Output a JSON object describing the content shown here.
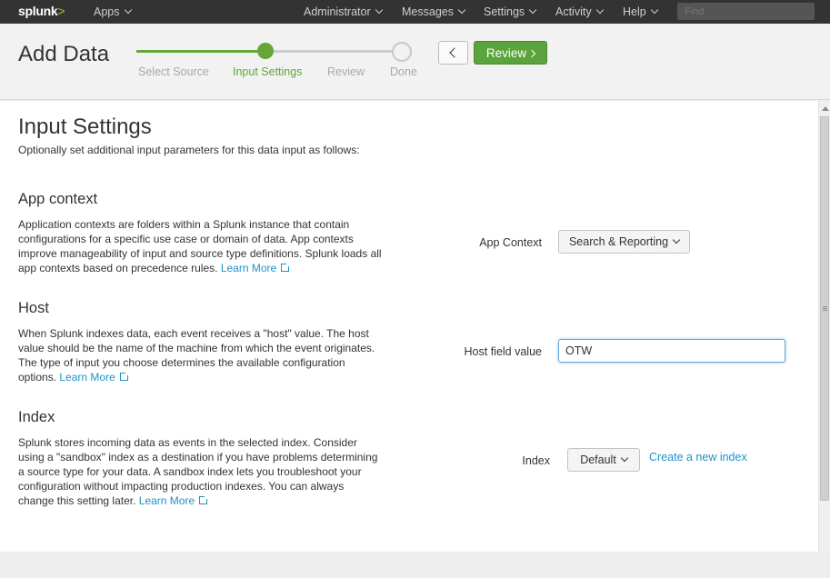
{
  "topnav": {
    "logo": "splunk",
    "logo_mark": ">",
    "apps": "Apps",
    "administrator": "Administrator",
    "messages": "Messages",
    "settings": "Settings",
    "activity": "Activity",
    "help": "Help",
    "find_placeholder": "Find"
  },
  "header": {
    "title": "Add Data",
    "steps": [
      "Select Source",
      "Input Settings",
      "Review",
      "Done"
    ],
    "active_step": "Input Settings",
    "review_button": "Review"
  },
  "main": {
    "title": "Input Settings",
    "subtitle": "Optionally set additional input parameters for this data input as follows:",
    "app_context": {
      "heading": "App context",
      "description": "Application contexts are folders within a Splunk instance that contain configurations for a specific use case or domain of data. App contexts improve manageability of input and source type definitions. Splunk loads all app contexts based on precedence rules.",
      "learn_more": "Learn More",
      "field_label": "App Context",
      "value": "Search & Reporting"
    },
    "host": {
      "heading": "Host",
      "description": "When Splunk indexes data, each event receives a \"host\" value. The host value should be the name of the machine from which the event originates. The type of input you choose determines the available configuration options.",
      "learn_more": "Learn More",
      "field_label": "Host field value",
      "value": "OTW"
    },
    "index": {
      "heading": "Index",
      "description": "Splunk stores incoming data as events in the selected index. Consider using a \"sandbox\" index as a destination if you have problems determining a source type for your data. A sandbox index lets you troubleshoot your configuration without impacting production indexes. You can always change this setting later.",
      "learn_more": "Learn More",
      "field_label": "Index",
      "value": "Default",
      "create_link": "Create a new index"
    }
  },
  "colors": {
    "accent_green": "#65a637",
    "link_blue": "#1e93c6",
    "topbar": "#333333"
  }
}
